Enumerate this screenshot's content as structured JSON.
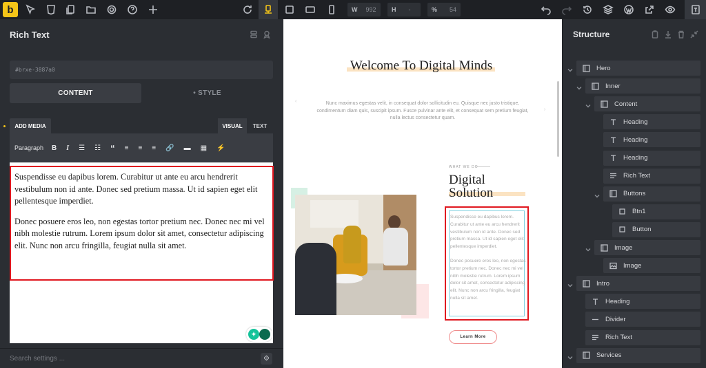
{
  "topbar": {
    "logo": "b",
    "width_label": "W",
    "width_value": "992",
    "height_label": "H",
    "height_value": "-",
    "percent_label": "%",
    "percent_value": "54"
  },
  "left_panel": {
    "title": "Rich Text",
    "element_id": "#brxe-3887a0",
    "tab_content": "CONTENT",
    "tab_style": "• STYLE",
    "add_media": "ADD MEDIA",
    "visual": "VISUAL",
    "text": "TEXT",
    "format_select": "Paragraph",
    "paragraph1": "Suspendisse eu dapibus lorem. Curabitur ut ante eu arcu hendrerit vestibulum non id ante. Donec sed pretium massa. Ut id sapien eget elit pellentesque imperdiet.",
    "paragraph2": "Donec posuere eros leo, non egestas tortor pretium nec. Donec nec mi vel nibh molestie rutrum. Lorem ipsum dolor sit amet, consectetur adipiscing elit. Nunc non arcu fringilla, feugiat nulla sit amet.",
    "search_placeholder": "Search settings ..."
  },
  "canvas": {
    "hero_title": "Welcome To Digital Minds",
    "hero_subtitle": "Nunc maximus egestas velit, in consequat dolor sollicitudin eu. Quisque nec justo tristique, condimentum diam quis, suscipit ipsum. Fusce pulvinar ante elit, et consequat sem pretium feugiat, nulla lectus consectetur quam.",
    "intro_label": "WHAT WE DO",
    "intro_title_line1": "Digital",
    "intro_title_line2": "Solution",
    "intro_p1": "Suspendisse eu dapibus lorem. Curabitur ut ante eu arcu hendrerit vestibulum non id ante. Donec sed pretium massa. Ut id sapien eget elit pellentesque imperdiet.",
    "intro_p2": "Donec posuere eros leo, non egestas tortor pretium nec. Donec nec mi vel nibh molestie rutrum. Lorem ipsum dolor sit amet, consectetur adipiscing elit. Nunc non arcu fringilla, feugiat nulla sit amet.",
    "button_label": "Learn More"
  },
  "structure": {
    "title": "Structure",
    "items": [
      {
        "label": "Hero",
        "icon": "section-icon"
      },
      {
        "label": "Inner",
        "icon": "container-icon"
      },
      {
        "label": "Content",
        "icon": "container-icon"
      },
      {
        "label": "Heading",
        "icon": "heading-icon"
      },
      {
        "label": "Heading",
        "icon": "heading-icon"
      },
      {
        "label": "Heading",
        "icon": "heading-icon"
      },
      {
        "label": "Rich Text",
        "icon": "richtext-icon"
      },
      {
        "label": "Buttons",
        "icon": "container-icon"
      },
      {
        "label": "Btn1",
        "icon": "button-icon"
      },
      {
        "label": "Button",
        "icon": "button-icon"
      },
      {
        "label": "Image",
        "icon": "container-icon"
      },
      {
        "label": "Image",
        "icon": "image-icon"
      },
      {
        "label": "Intro",
        "icon": "section-icon"
      },
      {
        "label": "Heading",
        "icon": "heading-icon"
      },
      {
        "label": "Divider",
        "icon": "divider-icon"
      },
      {
        "label": "Rich Text",
        "icon": "richtext-icon"
      },
      {
        "label": "Services",
        "icon": "section-icon"
      }
    ]
  },
  "colors": {
    "accent": "#f5c518",
    "highlight_box": "#e0171f",
    "hero_underline": "#fbe3c2"
  }
}
